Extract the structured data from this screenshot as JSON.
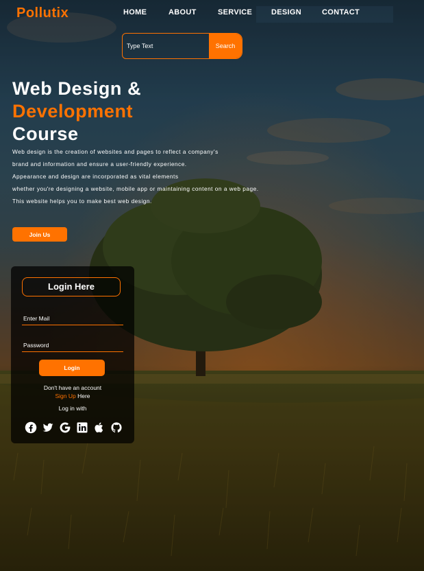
{
  "brand": "Pollutix",
  "nav": [
    {
      "label": "HOME"
    },
    {
      "label": "ABOUT"
    },
    {
      "label": "SERVICE"
    },
    {
      "label": "DESIGN"
    },
    {
      "label": "CONTACT"
    }
  ],
  "search": {
    "placeholder": "Type Text",
    "button": "Search"
  },
  "hero": {
    "title_line1": "Web Design &",
    "title_line2": "Development",
    "title_line3": "Course",
    "paragraph": [
      "Web design is the creation of websites and pages to reflect a company's",
      "brand and information and ensure a user-friendly experience.",
      "Appearance and design are incorporated as vital elements",
      "whether you're designing a website, mobile app or maintaining content on a web page.",
      "This website helps you to make best web design."
    ],
    "join_button": "Join Us"
  },
  "login": {
    "title": "Login Here",
    "email_placeholder": "Enter Mail",
    "password_placeholder": "Password",
    "button": "Login",
    "no_account": "Don't have an account",
    "signup_link": "Sign Up",
    "signup_suffix": " Here",
    "log_in_with": "Log in with",
    "socials": [
      "facebook-icon",
      "twitter-icon",
      "google-icon",
      "linkedin-icon",
      "apple-icon",
      "github-icon"
    ]
  },
  "colors": {
    "accent": "#ff7200",
    "card_bg": "#000000"
  }
}
